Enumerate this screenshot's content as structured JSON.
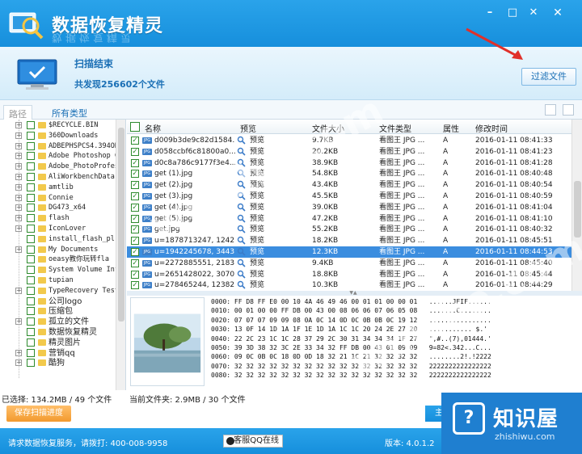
{
  "window": {
    "title": "数据恢复精灵",
    "minimize_glyph": "–",
    "maximize_glyph": "□",
    "close_glyph": "✕"
  },
  "status": {
    "scan_status": "扫描结束",
    "found_text": "共发现256602个文件",
    "filter_button": "过滤文件"
  },
  "tabs": {
    "path": "路径",
    "all_types": "所有类型"
  },
  "tree": {
    "items": [
      {
        "label": "$RECYCLE.BIN",
        "expander": "+",
        "cjk": false
      },
      {
        "label": "360Downloads",
        "expander": "+",
        "cjk": false
      },
      {
        "label": "ADBEPHSPCS4.394OD",
        "expander": "+",
        "cjk": false
      },
      {
        "label": "Adobe Photoshop C",
        "expander": "+",
        "cjk": false
      },
      {
        "label": "Adobe_PhotoProfes",
        "expander": "+",
        "cjk": false
      },
      {
        "label": "AliWorkbenchData",
        "expander": "+",
        "cjk": false
      },
      {
        "label": "amtlib",
        "expander": "+",
        "cjk": false
      },
      {
        "label": "Connie",
        "expander": "+",
        "cjk": false
      },
      {
        "label": "DG473_x64",
        "expander": "+",
        "cjk": false
      },
      {
        "label": "flash",
        "expander": "+",
        "cjk": false
      },
      {
        "label": "IconLover",
        "expander": "+",
        "cjk": false
      },
      {
        "label": "install_flash_pl",
        "expander": "",
        "cjk": false
      },
      {
        "label": "My Documents",
        "expander": "+",
        "cjk": false
      },
      {
        "label": "oeasy教你玩转fla",
        "expander": "",
        "cjk": false
      },
      {
        "label": "System Volume Inf",
        "expander": "",
        "cjk": false
      },
      {
        "label": "tupian",
        "expander": "",
        "cjk": false
      },
      {
        "label": "TypeRecovery Test",
        "expander": "+",
        "cjk": false
      },
      {
        "label": "公司logo",
        "expander": "",
        "cjk": true
      },
      {
        "label": "压缩包",
        "expander": "",
        "cjk": true
      },
      {
        "label": "孤立的文件",
        "expander": "+",
        "cjk": true
      },
      {
        "label": "数据恢复精灵",
        "expander": "",
        "cjk": true
      },
      {
        "label": "精灵图片",
        "expander": "",
        "cjk": true
      },
      {
        "label": "营销qq",
        "expander": "+",
        "cjk": true
      },
      {
        "label": "酷狗",
        "expander": "+",
        "cjk": true
      }
    ]
  },
  "list": {
    "columns": [
      "名称",
      "预览",
      "文件大小",
      "文件类型",
      "属性",
      "修改时间"
    ],
    "file_badge": "JPG",
    "rows": [
      {
        "name": "d009b3de9c82d1584...",
        "preview": "预览",
        "size": "9.7KB",
        "type": "看图王 JPG ...",
        "attr": "A",
        "time": "2016-01-11  08:41:33"
      },
      {
        "name": "d058ccbf6c81800a0...",
        "preview": "预览",
        "size": "20.2KB",
        "type": "看图王 JPG ...",
        "attr": "A",
        "time": "2016-01-11  08:41:23"
      },
      {
        "name": "d0c8a786c9177f3e4...",
        "preview": "预览",
        "size": "38.9KB",
        "type": "看图王 JPG ...",
        "attr": "A",
        "time": "2016-01-11  08:41:28"
      },
      {
        "name": "get (1).jpg",
        "preview": "预览",
        "size": "54.8KB",
        "type": "看图王 JPG ...",
        "attr": "A",
        "time": "2016-01-11  08:40:48"
      },
      {
        "name": "get (2).jpg",
        "preview": "预览",
        "size": "43.4KB",
        "type": "看图王 JPG ...",
        "attr": "A",
        "time": "2016-01-11  08:40:54"
      },
      {
        "name": "get (3).jpg",
        "preview": "预览",
        "size": "45.5KB",
        "type": "看图王 JPG ...",
        "attr": "A",
        "time": "2016-01-11  08:40:59"
      },
      {
        "name": "get (4).jpg",
        "preview": "预览",
        "size": "39.0KB",
        "type": "看图王 JPG ...",
        "attr": "A",
        "time": "2016-01-11  08:41:04"
      },
      {
        "name": "get (5).jpg",
        "preview": "预览",
        "size": "47.2KB",
        "type": "看图王 JPG ...",
        "attr": "A",
        "time": "2016-01-11  08:41:10"
      },
      {
        "name": "get.jpg",
        "preview": "预览",
        "size": "55.2KB",
        "type": "看图王 JPG ...",
        "attr": "A",
        "time": "2016-01-11  08:40:32"
      },
      {
        "name": "u=1878713247, 1242...",
        "preview": "预览",
        "size": "18.2KB",
        "type": "看图王 JPG ...",
        "attr": "A",
        "time": "2016-01-11  08:45:51"
      },
      {
        "name": "u=1942245678, 3443...",
        "preview": "预览",
        "size": "12.3KB",
        "type": "看图王 JPG ...",
        "attr": "A",
        "time": "2016-01-11  08:44:53"
      },
      {
        "name": "u=2272885551, 2183...",
        "preview": "预览",
        "size": "9.4KB",
        "type": "看图王 JPG ...",
        "attr": "A",
        "time": "2016-01-11  08:45:40"
      },
      {
        "name": "u=2651428022, 3070...",
        "preview": "预览",
        "size": "18.8KB",
        "type": "看图王 JPG ...",
        "attr": "A",
        "time": "2016-01-11  08:45:44"
      },
      {
        "name": "u=278465244, 12382...",
        "preview": "预览",
        "size": "10.3KB",
        "type": "看图王 JPG ...",
        "attr": "A",
        "time": "2016-01-11  08:44:29"
      }
    ],
    "selected_index": 10
  },
  "hex": [
    "0000: FF D8 FF E0 00 10 4A 46 49 46 00 01 01 00 00 01   ......JFIF......",
    "0010: 00 01 00 00 FF DB 00 43 00 08 06 06 07 06 05 08   .......C........",
    "0020: 07 07 07 09 09 08 0A 0C 14 0D 0C 0B 0B 0C 19 12   ................",
    "0030: 13 0F 14 1D 1A 1F 1E 1D 1A 1C 1C 20 24 2E 27 20   ........... $.' ",
    "0040: 22 2C 23 1C 1C 28 37 29 2C 30 31 34 34 34 1F 27   \",#..(7),01444.'",
    "0050: 39 3D 38 32 3C 2E 33 34 32 FF DB 00 43 01 09 09   9=82<.342...C...",
    "0060: 09 0C 0B 0C 18 0D 0D 18 32 21 1C 21 32 32 32 32   ........2!.!2222",
    "0070: 32 32 32 32 32 32 32 32 32 32 32 32 32 32 32 32   2222222222222222",
    "0080: 32 32 32 32 32 32 32 32 32 32 32 32 32 32 32 32   2222222222222222"
  ],
  "bottom": {
    "selected_info": "已选择: 134.2MB / 49 个文件",
    "current_folder": "当前文件夹: 2.9MB / 30 个文件",
    "save_button": "保存扫描进度",
    "home_button": "主"
  },
  "footer": {
    "service_text": "请求数据恢复服务，请拨打: 400-008-9958",
    "qq_button": "客服QQ在线",
    "version": "版本: 4.0.1.2"
  },
  "badge": {
    "glyph": "?",
    "name": "知识屋",
    "url": "zhishiwu.com"
  },
  "watermark": "wmzhe.com",
  "colors": {
    "accent": "#168fdc",
    "selected_row": "#3b8ddf",
    "check": "#2e8b2e",
    "save_button": "#f29a2e"
  }
}
